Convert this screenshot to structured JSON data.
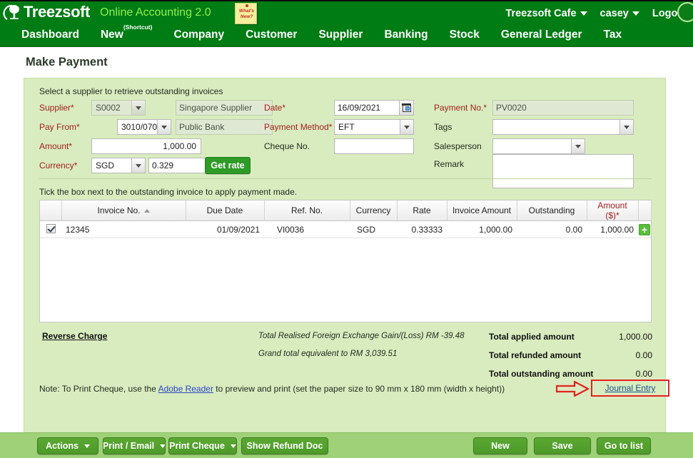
{
  "header": {
    "brand": "Treezsoft",
    "tagline": "Online Accounting 2.0",
    "whats_new": "What's New?",
    "company": "Treezsoft Cafe",
    "user": "casey",
    "logout": "Logout"
  },
  "nav": [
    {
      "label": "Dashboard",
      "sup": ""
    },
    {
      "label": "New",
      "sup": "(Shortcut)"
    },
    {
      "label": "Company",
      "sup": ""
    },
    {
      "label": "Customer",
      "sup": ""
    },
    {
      "label": "Supplier",
      "sup": ""
    },
    {
      "label": "Banking",
      "sup": ""
    },
    {
      "label": "Stock",
      "sup": ""
    },
    {
      "label": "General Ledger",
      "sup": ""
    },
    {
      "label": "Tax",
      "sup": ""
    }
  ],
  "page": {
    "title": "Make Payment",
    "hint": "Select a supplier to retrieve outstanding invoices",
    "tick_hint": "Tick the box next to the outstanding invoice to apply payment made."
  },
  "form": {
    "supplier_label": "Supplier*",
    "supplier_code": "S0002",
    "supplier_name": "Singapore Supplier",
    "payfrom_label": "Pay From*",
    "payfrom_code": "3010/070",
    "payfrom_name": "Public Bank",
    "amount_label": "Amount*",
    "amount_value": "1,000.00",
    "currency_label": "Currency*",
    "currency_value": "SGD",
    "rate_value": "0.329",
    "getrate_label": "Get rate",
    "date_label": "Date*",
    "date_value": "16/09/2021",
    "paymethod_label": "Payment Method*",
    "paymethod_value": "EFT",
    "chequeno_label": "Cheque No.",
    "chequeno_value": "",
    "paymentno_label": "Payment No.*",
    "paymentno_value": "PV0020",
    "tags_label": "Tags",
    "tags_value": "",
    "salesperson_label": "Salesperson",
    "salesperson_value": "",
    "remark_label": "Remark",
    "remark_value": ""
  },
  "table": {
    "columns": [
      "",
      "Invoice No.",
      "Due Date",
      "Ref. No.",
      "Currency",
      "Rate",
      "Invoice Amount",
      "Outstanding",
      "Amount ($)*",
      ""
    ],
    "sorted_column": "Invoice No.",
    "sort_direction": "asc",
    "rows": [
      {
        "checked": true,
        "invoice_no": "12345",
        "due_date": "01/09/2021",
        "ref_no": "VI0036",
        "currency": "SGD",
        "rate": "0.33333",
        "invoice_amount": "1,000.00",
        "outstanding": "0.00",
        "amount": "1,000.00",
        "add_icon": "+"
      }
    ]
  },
  "footer": {
    "reverse_charge": "Reverse Charge",
    "fx_line": "Total Realised Foreign Exchange Gain/(Loss) RM -39.48",
    "grand_total_line": "Grand total equivalent to RM 3,039.51",
    "totals": [
      {
        "label": "Total applied amount",
        "value": "1,000.00"
      },
      {
        "label": "Total refunded amount",
        "value": "0.00"
      },
      {
        "label": "Total outstanding amount",
        "value": "0.00"
      }
    ],
    "note_before": "Note: To Print Cheque, use the ",
    "note_link": "Adobe Reader",
    "note_after": " to preview and print (set the paper size to 90 mm x 180 mm (width x height))",
    "journal_entry": "Journal Entry"
  },
  "buttons": {
    "actions": "Actions",
    "print_email": "Print / Email",
    "print_cheque": "Print Cheque",
    "show_refund_doc": "Show Refund Doc",
    "new": "New",
    "save": "Save",
    "go_to_list": "Go to list"
  },
  "colors": {
    "header_green": "#007c14",
    "panel_green": "#d9ecbf",
    "bar_green": "#9fd178",
    "required_red": "#a42020",
    "annotation_red": "#e62020",
    "link_blue": "#2b44c4",
    "tagline_green": "#8ef24b"
  }
}
